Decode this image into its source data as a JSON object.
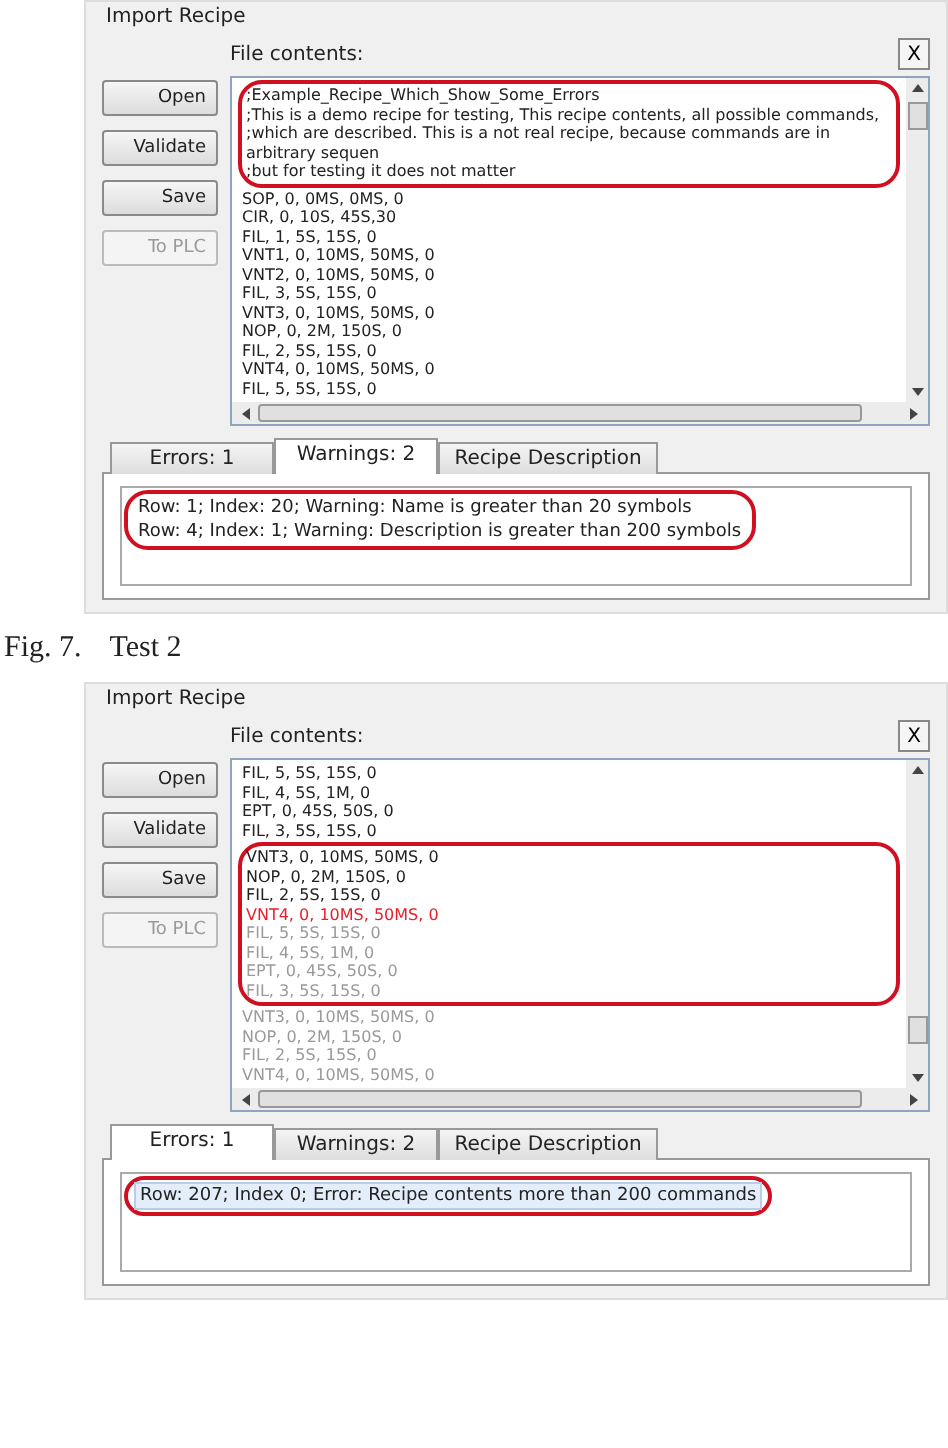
{
  "figures": [
    {
      "title": "Import Recipe",
      "file_label": "File contents:",
      "close_label": "X",
      "buttons": [
        {
          "label": "Open",
          "disabled": false
        },
        {
          "label": "Validate",
          "disabled": false
        },
        {
          "label": "Save",
          "disabled": false
        },
        {
          "label": "To PLC",
          "disabled": true
        }
      ],
      "blocks": [
        {
          "circled": true,
          "lines": [
            {
              "text": ";Example_Recipe_Which_Show_Some_Errors",
              "kind": "normal"
            },
            {
              "text": ";This is a demo recipe for testing, This recipe contents, all possible commands,",
              "kind": "normal"
            },
            {
              "text": ";which are described. This is a not real recipe, because commands are in arbitrary sequen",
              "kind": "normal"
            },
            {
              "text": ";but for testing it does not matter",
              "kind": "normal"
            }
          ]
        },
        {
          "circled": false,
          "lines": [
            {
              "text": "SOP, 0, 0MS, 0MS, 0",
              "kind": "normal"
            },
            {
              "text": "CIR, 0, 10S, 45S,30",
              "kind": "normal"
            },
            {
              "text": "FIL, 1, 5S, 15S, 0",
              "kind": "normal"
            },
            {
              "text": "VNT1, 0, 10MS, 50MS, 0",
              "kind": "normal"
            },
            {
              "text": "VNT2, 0, 10MS, 50MS, 0",
              "kind": "normal"
            },
            {
              "text": "FIL, 3, 5S, 15S, 0",
              "kind": "normal"
            },
            {
              "text": "VNT3, 0, 10MS, 50MS, 0",
              "kind": "normal"
            },
            {
              "text": "NOP, 0, 2M, 150S, 0",
              "kind": "normal"
            },
            {
              "text": "FIL, 2, 5S, 15S, 0",
              "kind": "normal"
            },
            {
              "text": "VNT4, 0, 10MS, 50MS, 0",
              "kind": "normal"
            },
            {
              "text": "FIL, 5, 5S, 15S, 0",
              "kind": "normal"
            }
          ]
        }
      ],
      "tabs": [
        {
          "label": "Errors: 1",
          "selected": false
        },
        {
          "label": "Warnings: 2",
          "selected": true
        },
        {
          "label": "Recipe Description",
          "selected": false
        }
      ],
      "messages_circled": true,
      "messages": [
        {
          "text": "Row: 1; Index: 20; Warning: Name is greater than 20 symbols",
          "selected": false
        },
        {
          "text": "Row: 4; Index: 1; Warning: Description is greater than 200 symbols",
          "selected": false
        }
      ]
    },
    {
      "title": "Import Recipe",
      "file_label": "File contents:",
      "close_label": "X",
      "buttons": [
        {
          "label": "Open",
          "disabled": false
        },
        {
          "label": "Validate",
          "disabled": false
        },
        {
          "label": "Save",
          "disabled": false
        },
        {
          "label": "To PLC",
          "disabled": true
        }
      ],
      "blocks": [
        {
          "circled": false,
          "lines": [
            {
              "text": "FIL, 5, 5S, 15S, 0",
              "kind": "normal"
            },
            {
              "text": "FIL, 4, 5S, 1M, 0",
              "kind": "normal"
            },
            {
              "text": "EPT, 0, 45S, 50S, 0",
              "kind": "normal"
            },
            {
              "text": "FIL, 3, 5S, 15S, 0",
              "kind": "normal"
            }
          ]
        },
        {
          "circled": true,
          "lines": [
            {
              "text": "VNT3, 0, 10MS, 50MS, 0",
              "kind": "normal"
            },
            {
              "text": "NOP, 0, 2M, 150S, 0",
              "kind": "normal"
            },
            {
              "text": "FIL, 2, 5S, 15S, 0",
              "kind": "normal"
            },
            {
              "text": "VNT4, 0, 10MS, 50MS, 0",
              "kind": "error"
            },
            {
              "text": "FIL, 5, 5S, 15S, 0",
              "kind": "skipped"
            },
            {
              "text": "FIL, 4, 5S, 1M, 0",
              "kind": "skipped"
            },
            {
              "text": "EPT, 0, 45S, 50S, 0",
              "kind": "skipped"
            },
            {
              "text": "FIL, 3, 5S, 15S, 0",
              "kind": "skipped"
            }
          ]
        },
        {
          "circled": false,
          "lines": [
            {
              "text": "VNT3, 0, 10MS, 50MS, 0",
              "kind": "skipped"
            },
            {
              "text": "NOP, 0, 2M, 150S, 0",
              "kind": "skipped"
            },
            {
              "text": "FIL, 2, 5S, 15S, 0",
              "kind": "skipped"
            },
            {
              "text": "VNT4, 0, 10MS, 50MS, 0",
              "kind": "skipped"
            }
          ]
        }
      ],
      "tabs": [
        {
          "label": "Errors: 1",
          "selected": true
        },
        {
          "label": "Warnings: 2",
          "selected": false
        },
        {
          "label": "Recipe Description",
          "selected": false
        }
      ],
      "messages_circled": true,
      "messages": [
        {
          "text": "Row: 207; Index 0; Error: Recipe contents more than 200 commands",
          "selected": true
        }
      ]
    }
  ],
  "caption": {
    "number": "Fig. 7.",
    "title": "Test 2"
  }
}
